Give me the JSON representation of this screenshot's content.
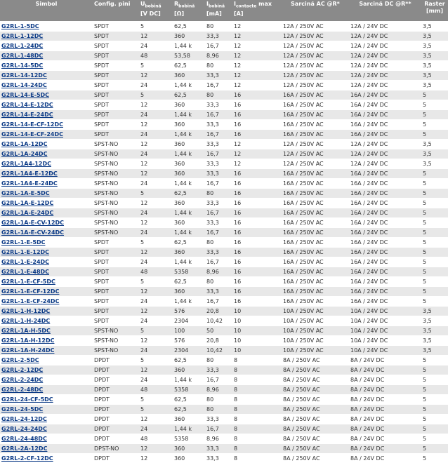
{
  "header": {
    "simbol": "Simbol",
    "config": "Config. pini",
    "u_main": "U",
    "u_sub": "bobină",
    "u_unit": "[V DC]",
    "r_main": "R",
    "r_sub": "bobină",
    "r_unit": "[Ω]",
    "i_main": "I",
    "i_sub": "bobină",
    "i_unit": "[mA]",
    "ic_main": "I",
    "ic_sub": "contacte",
    "ic_suffix": " max",
    "ic_unit": "[A]",
    "ac": "Sarcină AC @R*",
    "dc": "Sarcină DC @R**",
    "raster": "Raster",
    "raster_unit": "[mm]"
  },
  "rows": [
    [
      "G2RL-1-5DC",
      "SPDT",
      "5",
      "62,5",
      "80",
      "12",
      "12A / 250V AC",
      "12A / 24V DC",
      "3,5"
    ],
    [
      "G2RL-1-12DC",
      "SPDT",
      "12",
      "360",
      "33,3",
      "12",
      "12A / 250V AC",
      "12A / 24V DC",
      "3,5"
    ],
    [
      "G2RL-1-24DC",
      "SPDT",
      "24",
      "1,44 k",
      "16,7",
      "12",
      "12A / 250V AC",
      "12A / 24V DC",
      "3,5"
    ],
    [
      "G2RL-1-48DC",
      "SPDT",
      "48",
      "53,58",
      "8,96",
      "12",
      "12A / 250V AC",
      "12A / 24V DC",
      "3,5"
    ],
    [
      "G2RL-14-5DC",
      "SPDT",
      "5",
      "62,5",
      "80",
      "12",
      "12A / 250V AC",
      "12A / 24V DC",
      "3,5"
    ],
    [
      "G2RL-14-12DC",
      "SPDT",
      "12",
      "360",
      "33,3",
      "12",
      "12A / 250V AC",
      "12A / 24V DC",
      "3,5"
    ],
    [
      "G2RL-14-24DC",
      "SPDT",
      "24",
      "1,44 k",
      "16,7",
      "12",
      "12A / 250V AC",
      "12A / 24V DC",
      "3,5"
    ],
    [
      "G2RL-14-E-5DC",
      "SPDT",
      "5",
      "62,5",
      "80",
      "16",
      "16A / 250V AC",
      "16A / 24V DC",
      "5"
    ],
    [
      "G2RL-14-E-12DC",
      "SPDT",
      "12",
      "360",
      "33,3",
      "16",
      "16A / 250V AC",
      "16A / 24V DC",
      "5"
    ],
    [
      "G2RL-14-E-24DC",
      "SPDT",
      "24",
      "1,44 k",
      "16,7",
      "16",
      "16A / 250V AC",
      "16A / 24V DC",
      "5"
    ],
    [
      "G2RL-14-E-CF-12DC",
      "SPDT",
      "12",
      "360",
      "33,3",
      "16",
      "16A / 250V AC",
      "16A / 24V DC",
      "5"
    ],
    [
      "G2RL-14-E-CF-24DC",
      "SPDT",
      "24",
      "1,44 k",
      "16,7",
      "16",
      "16A / 250V AC",
      "16A / 24V DC",
      "5"
    ],
    [
      "G2RL-1A-12DC",
      "SPST-NO",
      "12",
      "360",
      "33,3",
      "12",
      "12A / 250V AC",
      "12A / 24V DC",
      "3,5"
    ],
    [
      "G2RL-1A-24DC",
      "SPST-NO",
      "24",
      "1,44 k",
      "16,7",
      "12",
      "12A / 250V AC",
      "12A / 24V DC",
      "3,5"
    ],
    [
      "G2RL-1A4-12DC",
      "SPST-NO",
      "12",
      "360",
      "33,3",
      "12",
      "12A / 250V AC",
      "12A / 24V DC",
      "3,5"
    ],
    [
      "G2RL-1A4-E-12DC",
      "SPST-NO",
      "12",
      "360",
      "33,3",
      "16",
      "16A / 250V AC",
      "16A / 24V DC",
      "5"
    ],
    [
      "G2RL-1A4-E-24DC",
      "SPST-NO",
      "24",
      "1,44 k",
      "16,7",
      "16",
      "16A / 250V AC",
      "16A / 24V DC",
      "5"
    ],
    [
      "G2RL-1A-E-5DC",
      "SPST-NO",
      "5",
      "62,5",
      "80",
      "16",
      "16A / 250V AC",
      "16A / 24V DC",
      "5"
    ],
    [
      "G2RL-1A-E-12DC",
      "SPST-NO",
      "12",
      "360",
      "33,3",
      "16",
      "16A / 250V AC",
      "16A / 24V DC",
      "5"
    ],
    [
      "G2RL-1A-E-24DC",
      "SPST-NO",
      "24",
      "1,44 k",
      "16,7",
      "16",
      "16A / 250V AC",
      "16A / 24V DC",
      "5"
    ],
    [
      "G2RL-1A-E-CV-12DC",
      "SPST-NO",
      "12",
      "360",
      "33,3",
      "16",
      "16A / 250V AC",
      "16A / 24V DC",
      "5"
    ],
    [
      "G2RL-1A-E-CV-24DC",
      "SPST-NO",
      "24",
      "1,44 k",
      "16,7",
      "16",
      "16A / 250V AC",
      "16A / 24V DC",
      "5"
    ],
    [
      "G2RL-1-E-5DC",
      "SPDT",
      "5",
      "62,5",
      "80",
      "16",
      "16A / 250V AC",
      "16A / 24V DC",
      "5"
    ],
    [
      "G2RL-1-E-12DC",
      "SPDT",
      "12",
      "360",
      "33,3",
      "16",
      "16A / 250V AC",
      "16A / 24V DC",
      "5"
    ],
    [
      "G2RL-1-E-24DC",
      "SPDT",
      "24",
      "1,44 k",
      "16,7",
      "16",
      "16A / 250V AC",
      "16A / 24V DC",
      "5"
    ],
    [
      "G2RL-1-E-48DC",
      "SPDT",
      "48",
      "5358",
      "8,96",
      "16",
      "16A / 250V AC",
      "16A / 24V DC",
      "5"
    ],
    [
      "G2RL-1-E-CF-5DC",
      "SPDT",
      "5",
      "62,5",
      "80",
      "16",
      "16A / 250V AC",
      "16A / 24V DC",
      "5"
    ],
    [
      "G2RL-1-E-CF-12DC",
      "SPDT",
      "12",
      "360",
      "33,3",
      "16",
      "16A / 250V AC",
      "16A / 24V DC",
      "5"
    ],
    [
      "G2RL-1-E-CF-24DC",
      "SPDT",
      "24",
      "1,44 k",
      "16,7",
      "16",
      "16A / 250V AC",
      "16A / 24V DC",
      "5"
    ],
    [
      "G2RL-1-H-12DC",
      "SPDT",
      "12",
      "576",
      "20,8",
      "10",
      "10A / 250V AC",
      "10A / 24V DC",
      "3,5"
    ],
    [
      "G2RL-1-H-24DC",
      "SPDT",
      "24",
      "2304",
      "10,42",
      "10",
      "10A / 250V AC",
      "10A / 24V DC",
      "3,5"
    ],
    [
      "G2RL-1A-H-5DC",
      "SPST-NO",
      "5",
      "100",
      "50",
      "10",
      "10A / 250V AC",
      "10A / 24V DC",
      "3,5"
    ],
    [
      "G2RL-1A-H-12DC",
      "SPST-NO",
      "12",
      "576",
      "20,8",
      "10",
      "10A / 250V AC",
      "10A / 24V DC",
      "3,5"
    ],
    [
      "G2RL-1A-H-24DC",
      "SPST-NO",
      "24",
      "2304",
      "10,42",
      "10",
      "10A / 250V AC",
      "10A / 24V DC",
      "3,5"
    ],
    [
      "G2RL-2-5DC",
      "DPDT",
      "5",
      "62,5",
      "80",
      "8",
      "8A / 250V AC",
      "8A / 24V DC",
      "5"
    ],
    [
      "G2RL-2-12DC",
      "DPDT",
      "12",
      "360",
      "33,3",
      "8",
      "8A / 250V AC",
      "8A / 24V DC",
      "5"
    ],
    [
      "G2RL-2-24DC",
      "DPDT",
      "24",
      "1,44 k",
      "16,7",
      "8",
      "8A / 250V AC",
      "8A / 24V DC",
      "5"
    ],
    [
      "G2RL-2-48DC",
      "DPDT",
      "48",
      "5358",
      "8,96",
      "8",
      "8A / 250V AC",
      "8A / 24V DC",
      "5"
    ],
    [
      "G2RL-24-CF-5DC",
      "DPDT",
      "5",
      "62,5",
      "80",
      "8",
      "8A / 250V AC",
      "8A / 24V DC",
      "5"
    ],
    [
      "G2RL-24-5DC",
      "DPDT",
      "5",
      "62,5",
      "80",
      "8",
      "8A / 250V AC",
      "8A / 24V DC",
      "5"
    ],
    [
      "G2RL-24-12DC",
      "DPDT",
      "12",
      "360",
      "33,3",
      "8",
      "8A / 250V AC",
      "8A / 24V DC",
      "5"
    ],
    [
      "G2RL-24-24DC",
      "DPDT",
      "24",
      "1,44 k",
      "16,7",
      "8",
      "8A / 250V AC",
      "8A / 24V DC",
      "5"
    ],
    [
      "G2RL-24-48DC",
      "DPDT",
      "48",
      "5358",
      "8,96",
      "8",
      "8A / 250V AC",
      "8A / 24V DC",
      "5"
    ],
    [
      "G2RL-2A-12DC",
      "DPST-NO",
      "12",
      "360",
      "33,3",
      "8",
      "8A / 250V AC",
      "8A / 24V DC",
      "5"
    ],
    [
      "G2RL-2-CF-12DC",
      "DPDT",
      "12",
      "360",
      "33,3",
      "8",
      "8A / 250V AC",
      "8A / 24V DC",
      "5"
    ]
  ]
}
